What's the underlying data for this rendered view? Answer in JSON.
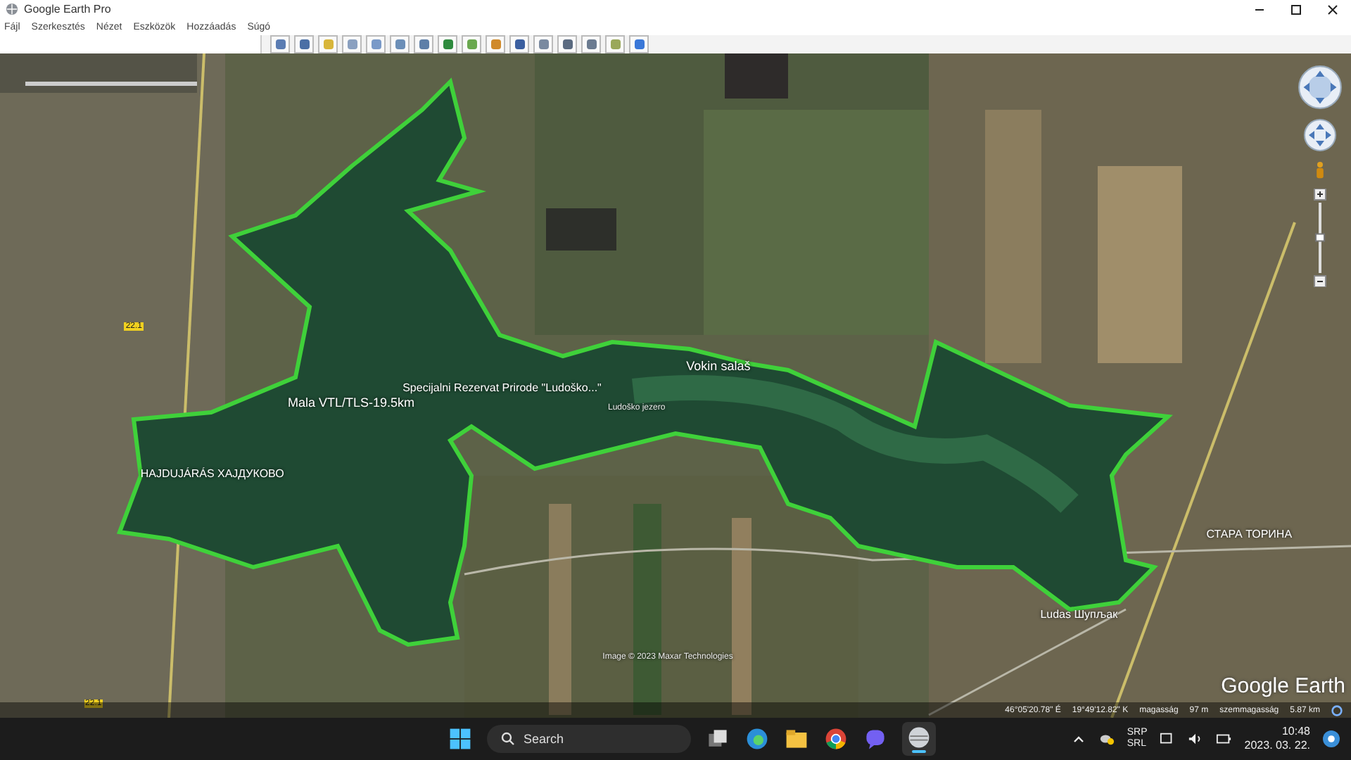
{
  "window": {
    "title": "Google Earth Pro"
  },
  "menu": [
    "Fájl",
    "Szerkesztés",
    "Nézet",
    "Eszközök",
    "Hozzáadás",
    "Súgó"
  ],
  "map": {
    "labels": [
      {
        "text": "Mala VTL/TLS-19.5km",
        "kind": "pin"
      },
      {
        "text": "Specijalni Rezervat Prirode \"Ludoško...\"",
        "kind": "place"
      },
      {
        "text": "Ludoško jezero",
        "kind": "small"
      },
      {
        "text": "Vokin salaš",
        "kind": "pin"
      },
      {
        "text": "HAJDUJÁRÁS ХАЈДУКОВО",
        "kind": "place"
      },
      {
        "text": "СТАРА ТОРИНА",
        "kind": "place"
      },
      {
        "text": "Ludas Шупљак",
        "kind": "place"
      },
      {
        "text": "22.1",
        "kind": "road"
      },
      {
        "text": "22.1",
        "kind": "road"
      },
      {
        "text": "Image © 2023 Maxar Technologies",
        "kind": "small"
      }
    ],
    "zoom": {
      "level": 0.55
    },
    "logo": "Google Earth",
    "status": [
      "46°05'20.78\" É",
      "19°49'12.82\" K",
      "magasság",
      "97 m",
      "szemmagasság",
      "5.87 km"
    ]
  },
  "taskbar": {
    "search": "Search",
    "language": [
      "SRP",
      "SRL"
    ],
    "time": "10:48",
    "date": "2023. 03. 22."
  }
}
